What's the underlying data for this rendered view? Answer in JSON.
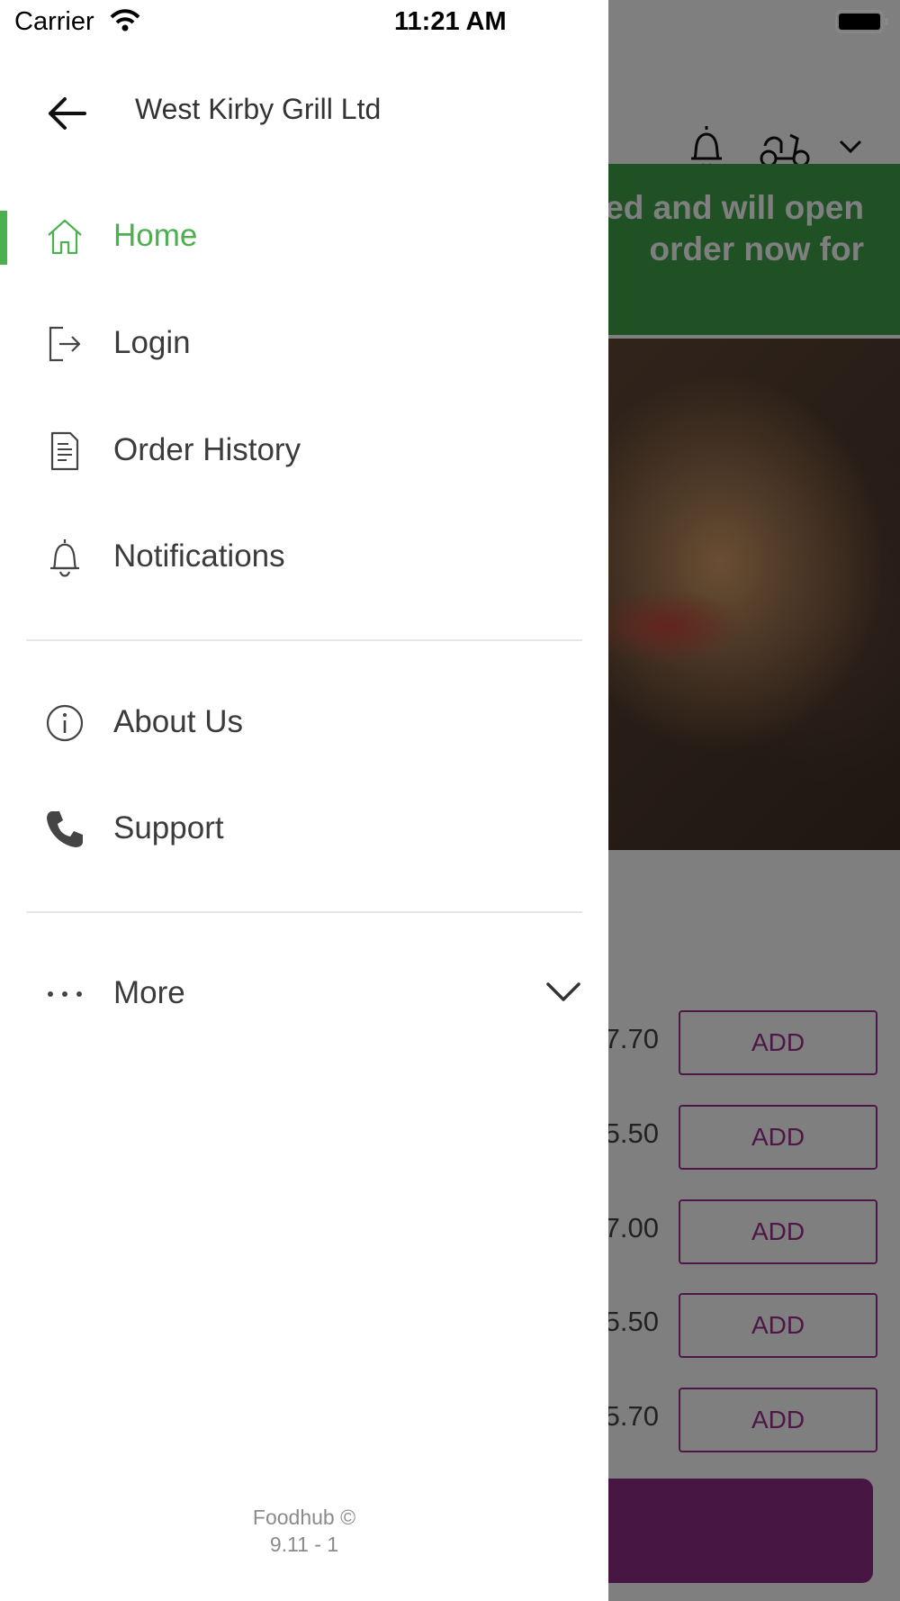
{
  "status_bar": {
    "carrier": "Carrier",
    "time": "11:21 AM"
  },
  "drawer": {
    "title": "West Kirby Grill Ltd",
    "accent_color": "#4caf50",
    "menu_primary": [
      {
        "label": "Home",
        "icon": "home-icon",
        "active": true
      },
      {
        "label": "Login",
        "icon": "login-icon",
        "active": false
      },
      {
        "label": "Order History",
        "icon": "receipt-icon",
        "active": false
      },
      {
        "label": "Notifications",
        "icon": "bell-icon",
        "active": false
      }
    ],
    "menu_secondary": [
      {
        "label": "About Us",
        "icon": "info-icon"
      },
      {
        "label": "Support",
        "icon": "phone-icon"
      }
    ],
    "more": {
      "label": "More",
      "icon": "more-dots-icon"
    },
    "footer": {
      "line1": "Foodhub ©",
      "line2": "9.11 - 1"
    }
  },
  "background": {
    "banner_line1": "ed and will open",
    "banner_line2": "order now for",
    "banner_color": "#3fa34a",
    "items": [
      {
        "price": "7.70",
        "add_label": "ADD"
      },
      {
        "price": "5.50",
        "add_label": "ADD"
      },
      {
        "price": "7.00",
        "add_label": "ADD"
      },
      {
        "price": "5.50",
        "add_label": "ADD"
      },
      {
        "price": "5.70",
        "add_label": "ADD"
      }
    ],
    "add_color": "#9b2e8f"
  }
}
